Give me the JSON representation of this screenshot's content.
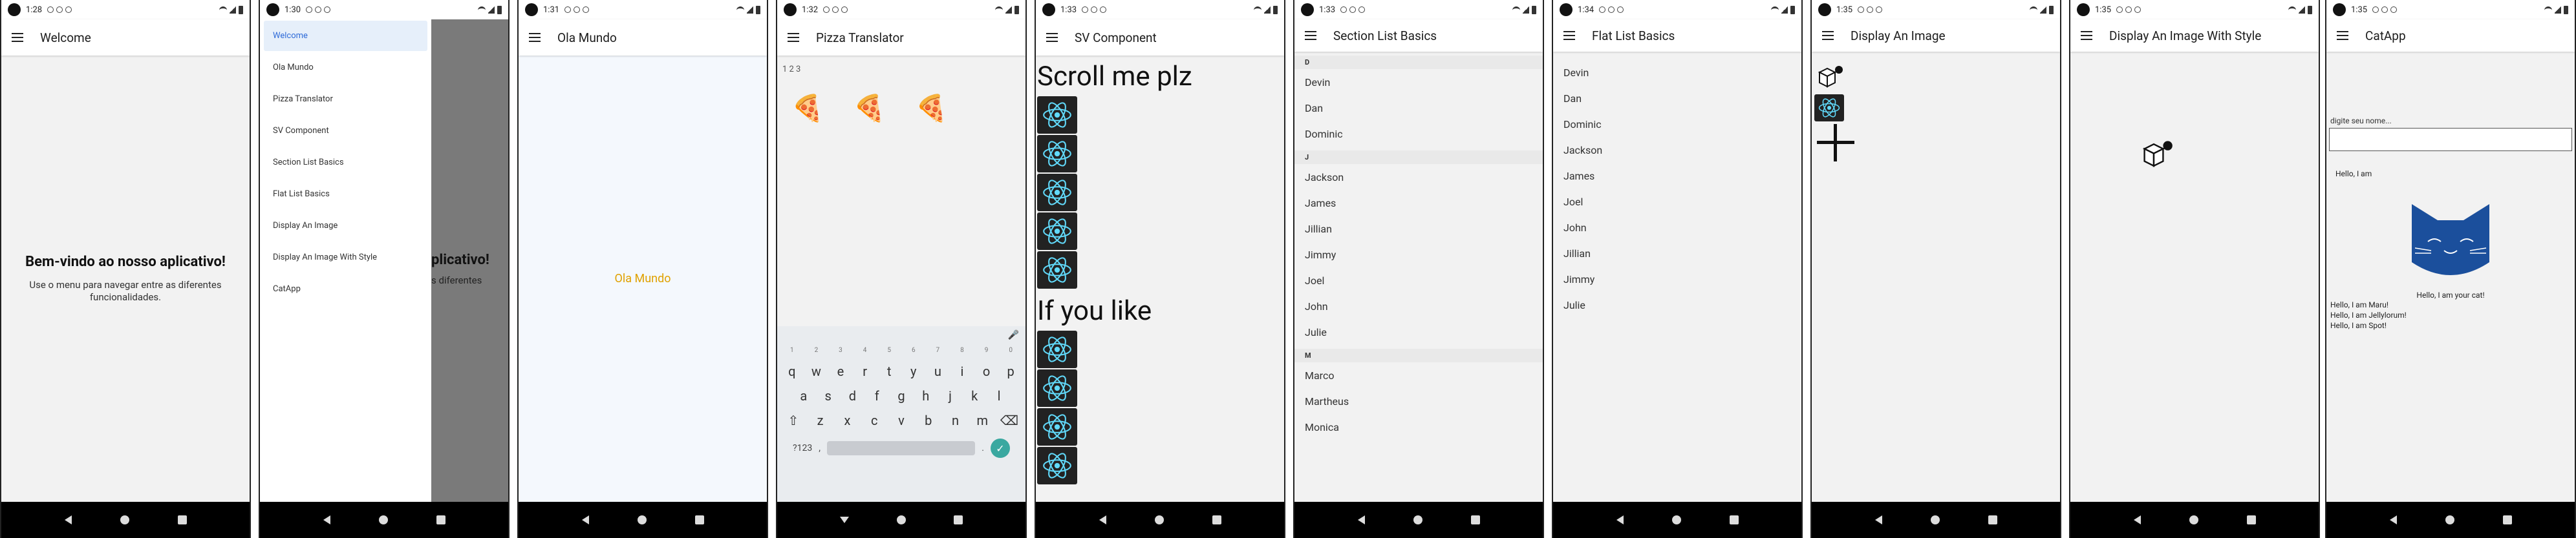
{
  "screens": [
    {
      "status_time": "1:28",
      "title": "Welcome",
      "heading": "Bem-vindo ao nosso aplicativo!",
      "subtitle": "Use o menu para navegar entre as diferentes funcionalidades."
    },
    {
      "status_time": "1:30",
      "drawer_items": [
        "Welcome",
        "Ola Mundo",
        "Pizza Translator",
        "SV Component",
        "Section List Basics",
        "Flat List Basics",
        "Display An Image",
        "Display An Image With Style",
        "CatApp"
      ],
      "peek_heading": "plicativo!",
      "peek_sub": "s diferentes"
    },
    {
      "status_time": "1:31",
      "title": "Ola Mundo",
      "message": "Ola Mundo"
    },
    {
      "status_time": "1:32",
      "title": "Pizza Translator",
      "input_value": "1 2 3",
      "pizzas": "🍕 🍕 🍕",
      "keyboard": {
        "nums": [
          "1",
          "2",
          "3",
          "4",
          "5",
          "6",
          "7",
          "8",
          "9",
          "0"
        ],
        "row1": [
          "q",
          "w",
          "e",
          "r",
          "t",
          "y",
          "u",
          "i",
          "o",
          "p"
        ],
        "row2": [
          "a",
          "s",
          "d",
          "f",
          "g",
          "h",
          "j",
          "k",
          "l"
        ],
        "row3": [
          "z",
          "x",
          "c",
          "v",
          "b",
          "n",
          "m"
        ],
        "symbols_key": "?123",
        "comma": ",",
        "period": "."
      }
    },
    {
      "status_time": "1:33",
      "title": "SV Component",
      "scroll_text": "Scroll me plz",
      "if_text": "If you like"
    },
    {
      "status_time": "1:33",
      "title": "Section List Basics",
      "sections": [
        {
          "title": "D",
          "items": [
            "Devin",
            "Dan",
            "Dominic"
          ]
        },
        {
          "title": "J",
          "items": [
            "Jackson",
            "James",
            "Jillian",
            "Jimmy",
            "Joel",
            "John",
            "Julie"
          ]
        },
        {
          "title": "M",
          "items": [
            "Marco",
            "Martheus",
            "Monica"
          ]
        }
      ]
    },
    {
      "status_time": "1:34",
      "title": "Flat List Basics",
      "items": [
        "Devin",
        "Dan",
        "Dominic",
        "Jackson",
        "James",
        "Joel",
        "John",
        "Jillian",
        "Jimmy",
        "Julie"
      ]
    },
    {
      "status_time": "1:35",
      "title": "Display An Image"
    },
    {
      "status_time": "1:35",
      "title": "Display An Image With Style"
    },
    {
      "status_time": "1:35",
      "title": "CatApp",
      "input_label": "digite seu nome...",
      "hello_prefix": "Hello, I am",
      "cat_caption": "Hello, I am your cat!",
      "cat_lines": [
        "Hello, I am Maru!",
        "Hello, I am Jellylorum!",
        "Hello, I am Spot!"
      ]
    }
  ],
  "colors": {
    "accent": "#2f6bd8",
    "ola": "#e0a100",
    "cat": "#1b4f9c",
    "react": "#61dafb"
  }
}
